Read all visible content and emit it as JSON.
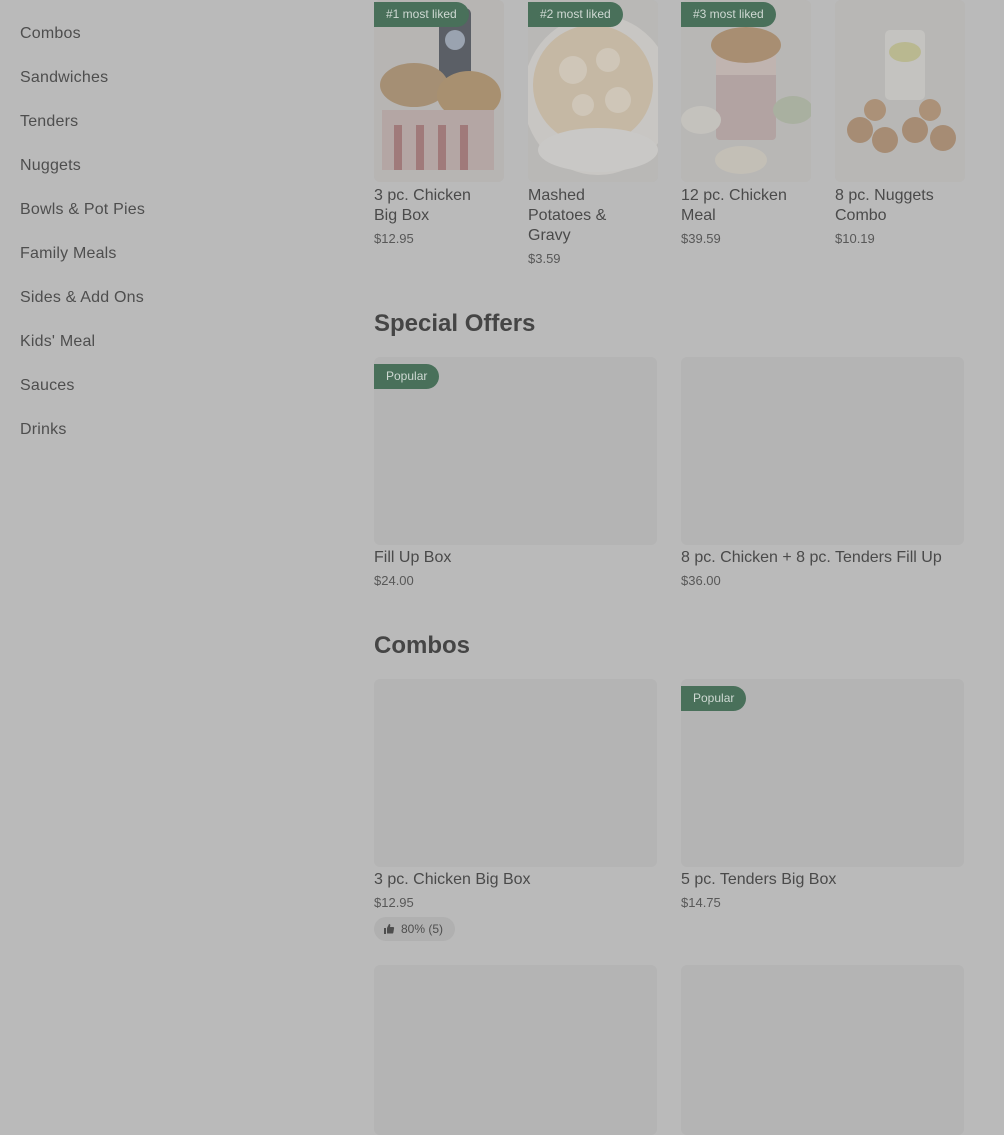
{
  "sidebar": {
    "items": [
      {
        "label": "Combos"
      },
      {
        "label": "Sandwiches"
      },
      {
        "label": "Tenders"
      },
      {
        "label": "Nuggets"
      },
      {
        "label": "Bowls & Pot Pies"
      },
      {
        "label": "Family Meals"
      },
      {
        "label": "Sides & Add Ons"
      },
      {
        "label": "Kids' Meal"
      },
      {
        "label": "Sauces"
      },
      {
        "label": "Drinks"
      }
    ]
  },
  "most_liked": {
    "items": [
      {
        "badge": "#1 most liked",
        "title_line1": "3 pc. Chicken",
        "title_line2": "Big Box",
        "title_line3": "",
        "price": "$12.95"
      },
      {
        "badge": "#2 most liked",
        "title_line1": "Mashed",
        "title_line2": "Potatoes &",
        "title_line3": "Gravy",
        "price": "$3.59"
      },
      {
        "badge": "#3 most liked",
        "title_line1": "12 pc. Chicken",
        "title_line2": "Meal",
        "title_line3": "",
        "price": "$39.59"
      },
      {
        "badge": "",
        "title_line1": "8 pc. Nuggets",
        "title_line2": "Combo",
        "title_line3": "",
        "price": "$10.19"
      }
    ]
  },
  "special_offers": {
    "title": "Special Offers",
    "items": [
      {
        "badge": "Popular",
        "title": "Fill Up Box",
        "price": "$24.00"
      },
      {
        "badge": "",
        "title": "8 pc. Chicken + 8 pc. Tenders Fill Up",
        "price": "$36.00"
      }
    ]
  },
  "combos": {
    "title": "Combos",
    "items": [
      {
        "badge": "",
        "title": "3 pc. Chicken Big Box",
        "price": "$12.95",
        "rating": "80% (5)"
      },
      {
        "badge": "Popular",
        "title": "5 pc. Tenders Big Box",
        "price": "$14.75",
        "rating": ""
      }
    ]
  },
  "colors": {
    "overlay_bg": "#bababa",
    "badge_bg": "#49705a",
    "badge_text": "#cfd9d3"
  }
}
